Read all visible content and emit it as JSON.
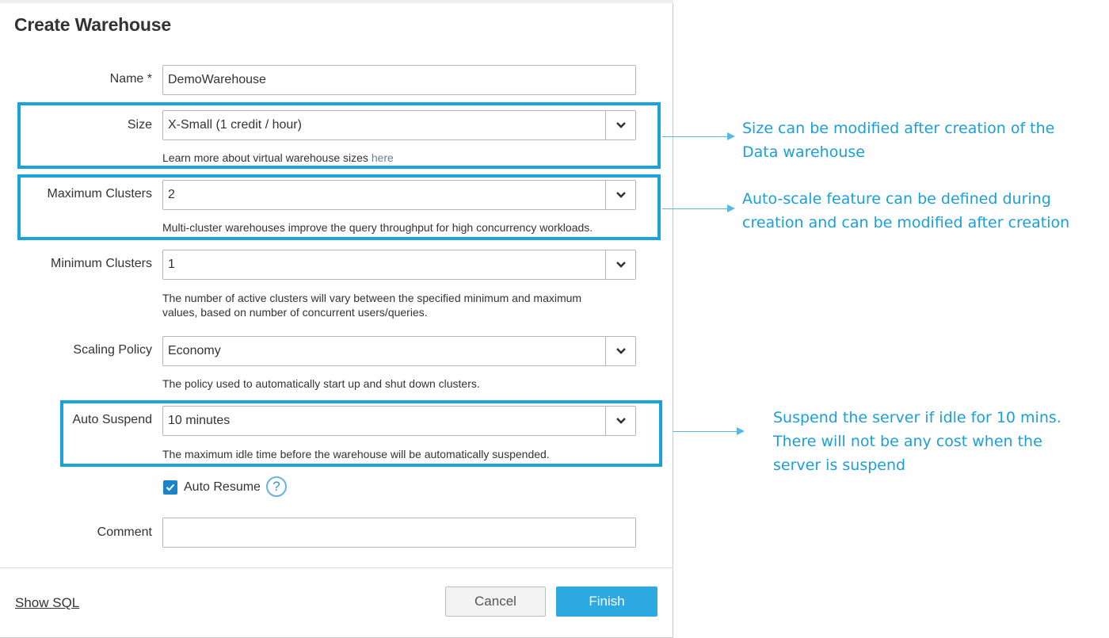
{
  "dialog": {
    "title": "Create Warehouse",
    "name": {
      "label": "Name *",
      "value": "DemoWarehouse"
    },
    "size": {
      "label": "Size",
      "value": "X-Small  (1 credit / hour)",
      "help": "Learn more about virtual warehouse sizes ",
      "help_link": "here"
    },
    "max_clusters": {
      "label": "Maximum Clusters",
      "value": "2",
      "help": "Multi-cluster warehouses improve the query throughput for high concurrency workloads."
    },
    "min_clusters": {
      "label": "Minimum Clusters",
      "value": "1",
      "help_line1": "The number of active clusters will vary between the specified minimum and maximum",
      "help_line2": "values, based on number of concurrent users/queries."
    },
    "scaling_policy": {
      "label": "Scaling Policy",
      "value": "Economy",
      "help": "The policy used to automatically start up and shut down clusters."
    },
    "auto_suspend": {
      "label": "Auto Suspend",
      "value": "10 minutes",
      "help": "The maximum idle time before the warehouse will be automatically suspended."
    },
    "auto_resume": {
      "label": "Auto Resume",
      "checked": true,
      "help_icon": "?"
    },
    "comment": {
      "label": "Comment",
      "value": ""
    },
    "footer": {
      "show_sql": "Show SQL",
      "cancel": "Cancel",
      "finish": "Finish"
    }
  },
  "annotations": {
    "size_line1": "Size can be modified after creation of the",
    "size_line2": "Data warehouse",
    "autoscale_line1": "Auto-scale feature can be defined during",
    "autoscale_line2": "creation and can be modified after creation",
    "suspend_line1": "Suspend the server if idle for 10 mins.",
    "suspend_line2": "There will not be any cost when the",
    "suspend_line3": "server is suspend"
  },
  "colors": {
    "highlight": "#1aa3db",
    "annotation_text": "#1b9fd8",
    "finish_button": "#2ca9e1",
    "checkbox": "#1a84c7"
  },
  "icons": {
    "select_arrow": "chevron-down-icon",
    "checkbox": "checkmark-icon",
    "help": "question-circle-icon"
  }
}
